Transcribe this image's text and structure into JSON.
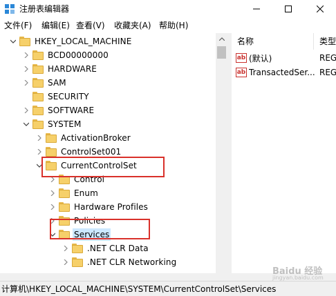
{
  "window": {
    "title": "注册表编辑器",
    "icon": "registry-editor-icon"
  },
  "menu": [
    "文件(F)",
    "编辑(E)",
    "查看(V)",
    "收藏夹(A)",
    "帮助(H)"
  ],
  "tree": [
    {
      "label": "HKEY_LOCAL_MACHINE",
      "depth": 1,
      "chevron": "down"
    },
    {
      "label": "BCD00000000",
      "depth": 2,
      "chevron": "right"
    },
    {
      "label": "HARDWARE",
      "depth": 2,
      "chevron": "right"
    },
    {
      "label": "SAM",
      "depth": 2,
      "chevron": "right"
    },
    {
      "label": "SECURITY",
      "depth": 2,
      "chevron": "none"
    },
    {
      "label": "SOFTWARE",
      "depth": 2,
      "chevron": "right"
    },
    {
      "label": "SYSTEM",
      "depth": 2,
      "chevron": "down"
    },
    {
      "label": "ActivationBroker",
      "depth": 3,
      "chevron": "right"
    },
    {
      "label": "ControlSet001",
      "depth": 3,
      "chevron": "right"
    },
    {
      "label": "CurrentControlSet",
      "depth": 3,
      "chevron": "down"
    },
    {
      "label": "Control",
      "depth": 4,
      "chevron": "right"
    },
    {
      "label": "Enum",
      "depth": 4,
      "chevron": "right"
    },
    {
      "label": "Hardware Profiles",
      "depth": 4,
      "chevron": "right"
    },
    {
      "label": "Policies",
      "depth": 4,
      "chevron": "right"
    },
    {
      "label": "Services",
      "depth": 4,
      "chevron": "down",
      "selected": true
    },
    {
      "label": ".NET CLR Data",
      "depth": 5,
      "chevron": "right"
    },
    {
      "label": ".NET CLR Networking",
      "depth": 5,
      "chevron": "right"
    }
  ],
  "list": {
    "columns": [
      "名称",
      "类型"
    ],
    "rows": [
      {
        "name": "(默认)",
        "type": "REG",
        "icon": "string-value-icon"
      },
      {
        "name": "TransactedSer...",
        "type": "REG",
        "icon": "string-value-icon"
      }
    ]
  },
  "status": {
    "path": "计算机\\HKEY_LOCAL_MACHINE\\SYSTEM\\CurrentControlSet\\Services"
  },
  "watermark": {
    "text": "Baidu 经验",
    "sub": "jingyan.baidu.com"
  },
  "colors": {
    "highlight_box": "#d9302a",
    "selection": "#cce8ff",
    "folder": "#f6d06a"
  }
}
